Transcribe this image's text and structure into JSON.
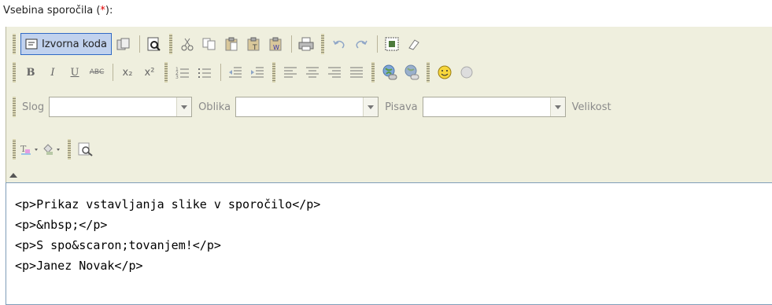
{
  "field": {
    "label_prefix": "Vsebina sporočila (",
    "required_mark": "*",
    "label_suffix": "):"
  },
  "toolbar": {
    "source_label": "Izvorna koda",
    "styles": {
      "slog_label": "Slog",
      "oblika_label": "Oblika",
      "pisava_label": "Pisava",
      "velikost_label": "Velikost"
    },
    "format": {
      "bold": "B",
      "italic": "I",
      "underline": "U",
      "strike": "ABC",
      "sub": "x₂",
      "sup": "x²"
    }
  },
  "code": {
    "lines": [
      "<p>Prikaz vstavljanja slike v sporočilo</p>",
      "<p>&nbsp;</p>",
      "<p>S spo&scaron;tovanjem!</p>",
      "<p>Janez Novak</p>"
    ]
  }
}
